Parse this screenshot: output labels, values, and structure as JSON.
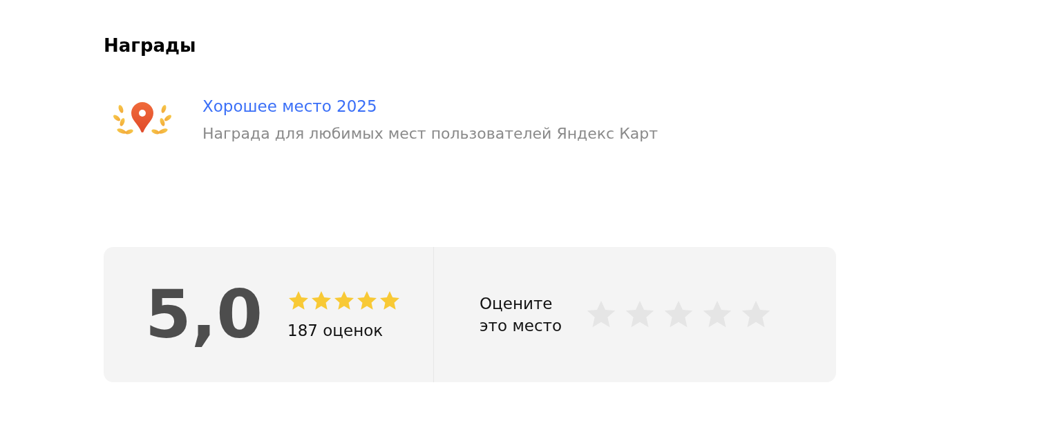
{
  "awards_section": {
    "title": "Награды",
    "awards": [
      {
        "title": "Хорошее место 2025",
        "description": "Награда для любимых мест пользователей Яндекс Карт"
      }
    ]
  },
  "rating": {
    "score": "5,0",
    "stars": 5,
    "count": "187 оценок"
  },
  "rate_prompt": {
    "label": "Оцените\nэто место"
  }
}
